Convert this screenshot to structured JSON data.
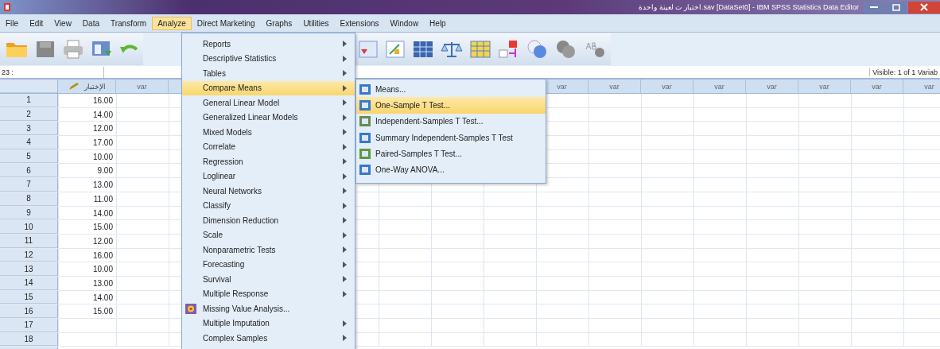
{
  "window": {
    "title": "اختبار ت لعينة واحدة.sav [DataSet0] - IBM SPSS Statistics Data Editor"
  },
  "menubar": [
    {
      "label": "File",
      "selected": false
    },
    {
      "label": "Edit",
      "selected": false
    },
    {
      "label": "View",
      "selected": false
    },
    {
      "label": "Data",
      "selected": false
    },
    {
      "label": "Transform",
      "selected": false
    },
    {
      "label": "Analyze",
      "selected": true
    },
    {
      "label": "Direct Marketing",
      "selected": false
    },
    {
      "label": "Graphs",
      "selected": false
    },
    {
      "label": "Utilities",
      "selected": false
    },
    {
      "label": "Extensions",
      "selected": false
    },
    {
      "label": "Window",
      "selected": false
    },
    {
      "label": "Help",
      "selected": false
    }
  ],
  "cell_editor": {
    "cell_ref": "23 :",
    "visible": "Visible: 1 of 1 Variab"
  },
  "grid": {
    "columns": [
      {
        "header": "الإختبار",
        "kind": "numeric"
      },
      {
        "header": "var",
        "kind": "empty"
      }
    ],
    "right_columns": [
      "var",
      "var",
      "var",
      "var",
      "var",
      "var",
      "var",
      "var"
    ],
    "rows": [
      {
        "number": "1",
        "value": "16.00"
      },
      {
        "number": "2",
        "value": "14.00"
      },
      {
        "number": "3",
        "value": "12.00"
      },
      {
        "number": "4",
        "value": "17.00"
      },
      {
        "number": "5",
        "value": "10.00"
      },
      {
        "number": "6",
        "value": "9.00"
      },
      {
        "number": "7",
        "value": "13.00"
      },
      {
        "number": "8",
        "value": "11.00"
      },
      {
        "number": "9",
        "value": "14.00"
      },
      {
        "number": "10",
        "value": "15.00"
      },
      {
        "number": "11",
        "value": "12.00"
      },
      {
        "number": "12",
        "value": "16.00"
      },
      {
        "number": "13",
        "value": "10.00"
      },
      {
        "number": "14",
        "value": "13.00"
      },
      {
        "number": "15",
        "value": "14.00"
      },
      {
        "number": "16",
        "value": "15.00"
      },
      {
        "number": "17"
      },
      {
        "number": "18"
      }
    ]
  },
  "analyze_menu": [
    {
      "label": "Reports",
      "kind": "submenu",
      "selected": false
    },
    {
      "label": "Descriptive Statistics",
      "kind": "submenu",
      "selected": false
    },
    {
      "label": "Tables",
      "kind": "submenu",
      "selected": false
    },
    {
      "label": "Compare Means",
      "kind": "submenu",
      "selected": true
    },
    {
      "label": "General Linear Model",
      "kind": "submenu",
      "selected": false
    },
    {
      "label": "Generalized Linear Models",
      "kind": "submenu",
      "selected": false
    },
    {
      "label": "Mixed Models",
      "kind": "submenu",
      "selected": false
    },
    {
      "label": "Correlate",
      "kind": "submenu",
      "selected": false
    },
    {
      "label": "Regression",
      "kind": "submenu",
      "selected": false
    },
    {
      "label": "Loglinear",
      "kind": "submenu",
      "selected": false
    },
    {
      "label": "Neural Networks",
      "kind": "submenu",
      "selected": false
    },
    {
      "label": "Classify",
      "kind": "submenu",
      "selected": false
    },
    {
      "label": "Dimension Reduction",
      "kind": "submenu",
      "selected": false
    },
    {
      "label": "Scale",
      "kind": "submenu",
      "selected": false
    },
    {
      "label": "Nonparametric Tests",
      "kind": "submenu",
      "selected": false
    },
    {
      "label": "Forecasting",
      "kind": "submenu",
      "selected": false
    },
    {
      "label": "Survival",
      "kind": "submenu",
      "selected": false
    },
    {
      "label": "Multiple Response",
      "kind": "submenu",
      "selected": false
    },
    {
      "label": "Missing Value Analysis...",
      "kind": "action",
      "selected": false
    },
    {
      "label": "Multiple Imputation",
      "kind": "submenu",
      "selected": false
    },
    {
      "label": "Complex Samples",
      "kind": "submenu",
      "selected": false
    }
  ],
  "compare_means_menu": [
    {
      "label": "Means...",
      "selected": false
    },
    {
      "label": "One-Sample T Test...",
      "selected": true
    },
    {
      "label": "Independent-Samples T Test...",
      "selected": false
    },
    {
      "label": "Summary Independent-Samples T Test",
      "selected": false
    },
    {
      "label": "Paired-Samples T Test...",
      "selected": false
    },
    {
      "label": "One-Way ANOVA...",
      "selected": false
    }
  ]
}
